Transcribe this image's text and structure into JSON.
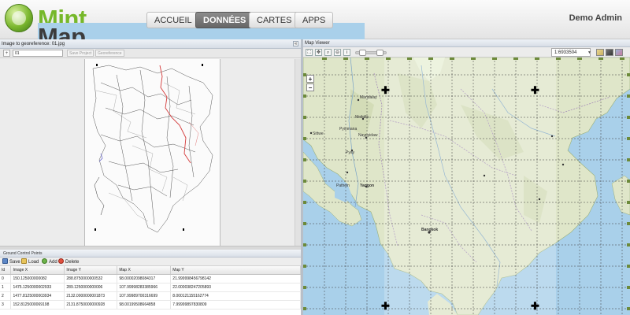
{
  "header": {
    "brand_part1": "Map",
    "brand_part2": "Mint",
    "nav": [
      {
        "label": "ACCUEIL",
        "active": false
      },
      {
        "label": "DONNÉES",
        "active": true
      },
      {
        "label": "CARTES",
        "active": false
      },
      {
        "label": "APPS",
        "active": false
      }
    ],
    "user": "Demo Admin"
  },
  "georef": {
    "title": "Image to georeference: 01.jpg",
    "collapse_glyph": "«",
    "input_value": "01",
    "save_project_label": "Save Project",
    "georeference_label": "Georeference"
  },
  "gcp": {
    "title": "Ground Control Points",
    "tools": {
      "save": "Save",
      "load": "Load",
      "add": "Add",
      "delete": "Delete"
    },
    "columns": [
      "Id",
      "Image X",
      "Image Y",
      "Map X",
      "Map Y"
    ],
    "rows": [
      [
        "0",
        "150.125000000082",
        "288.8750000000532",
        "98.00002098084317",
        "21.999998456798142"
      ],
      [
        "1",
        "1475.1250000002933",
        "289.1250000000006",
        "107.99998283385966",
        "22.000038247205893"
      ],
      [
        "2",
        "1477.8125000003934",
        "2132.0000000001873",
        "107.99989700316699",
        "8.000121155162774"
      ],
      [
        "3",
        "152.8125000069198",
        "2131.8750000000928",
        "98.00199508664858",
        "7.99999897830809"
      ]
    ]
  },
  "viewer": {
    "title": "Map Viewer",
    "scale": "1:6933504",
    "zoom_in": "+",
    "zoom_out": "−",
    "map_labels": [
      {
        "text": "Mandalay"
      },
      {
        "text": "Meiktila"
      },
      {
        "text": "Naypyidaw"
      },
      {
        "text": "Pyinmana"
      },
      {
        "text": "Pyay"
      },
      {
        "text": "Pathein"
      },
      {
        "text": "Yangon"
      },
      {
        "text": "Bangkok"
      },
      {
        "text": "Sittwe"
      }
    ]
  },
  "colors": {
    "brand_green": "#76b82a",
    "nav_active": "#777777",
    "land": "#dfe6c9",
    "land_highlight": "#e8f0d6",
    "sea": "#a9d0ea",
    "grid": "#3a3a3a"
  }
}
